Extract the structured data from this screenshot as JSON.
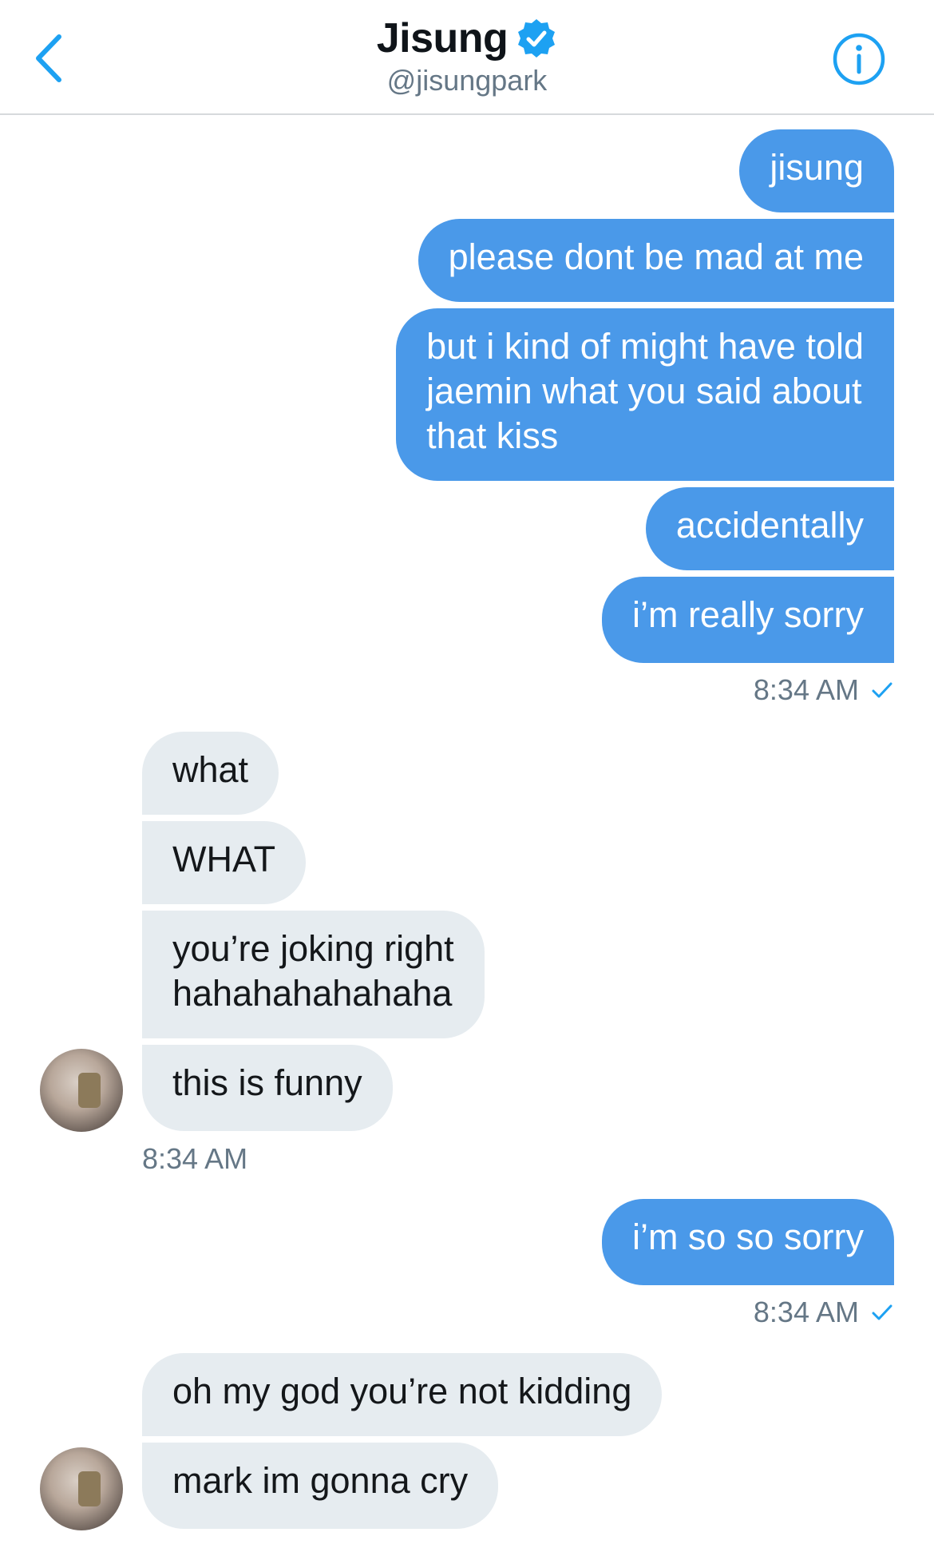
{
  "header": {
    "name": "Jisung",
    "handle": "@jisungpark"
  },
  "colors": {
    "accent": "#1DA1F2",
    "outgoing_bubble": "#4A99E9",
    "incoming_bubble": "#E6ECF0",
    "timestamp": "#657786"
  },
  "icons": {
    "back": "chevron-left-icon",
    "verified": "verified-badge-icon",
    "info": "info-icon",
    "read": "checkmark-icon"
  },
  "messages": {
    "out_1": [
      "jisung",
      "please dont be mad at me",
      "but i kind of might have told\njaemin what you said about\nthat kiss",
      "accidentally",
      "i’m really sorry"
    ],
    "out_1_time": "8:34 AM",
    "in_1": [
      "what",
      "WHAT",
      "you’re joking right\nhahahahahahaha",
      "this is funny"
    ],
    "in_1_time": "8:34 AM",
    "out_2": [
      "i’m so so sorry"
    ],
    "out_2_time": "8:34 AM",
    "in_2": [
      "oh my god you’re not kidding",
      "mark im gonna cry"
    ]
  }
}
